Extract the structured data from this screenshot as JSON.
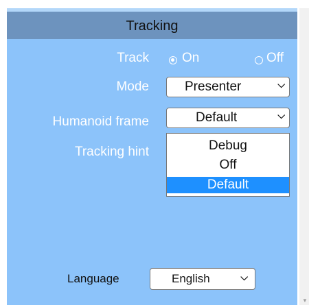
{
  "header": {
    "title": "Tracking"
  },
  "track": {
    "label": "Track",
    "options": [
      {
        "label": "On",
        "checked": true
      },
      {
        "label": "Off",
        "checked": false
      }
    ]
  },
  "mode": {
    "label": "Mode",
    "value": "Presenter"
  },
  "humanoid_frame": {
    "label": "Humanoid frame",
    "value": "Default",
    "options": [
      "Debug",
      "Off",
      "Default"
    ],
    "highlighted": "Default"
  },
  "tracking_hint": {
    "label": "Tracking hint"
  },
  "language": {
    "label": "Language",
    "value": "English"
  },
  "colors": {
    "panel": "#8cc3fa",
    "header": "#6d93be",
    "highlight": "#1e90ff"
  },
  "icons": {
    "dropdown": "chevron-down-icon",
    "scroll": "scroll-down-arrow-icon"
  }
}
